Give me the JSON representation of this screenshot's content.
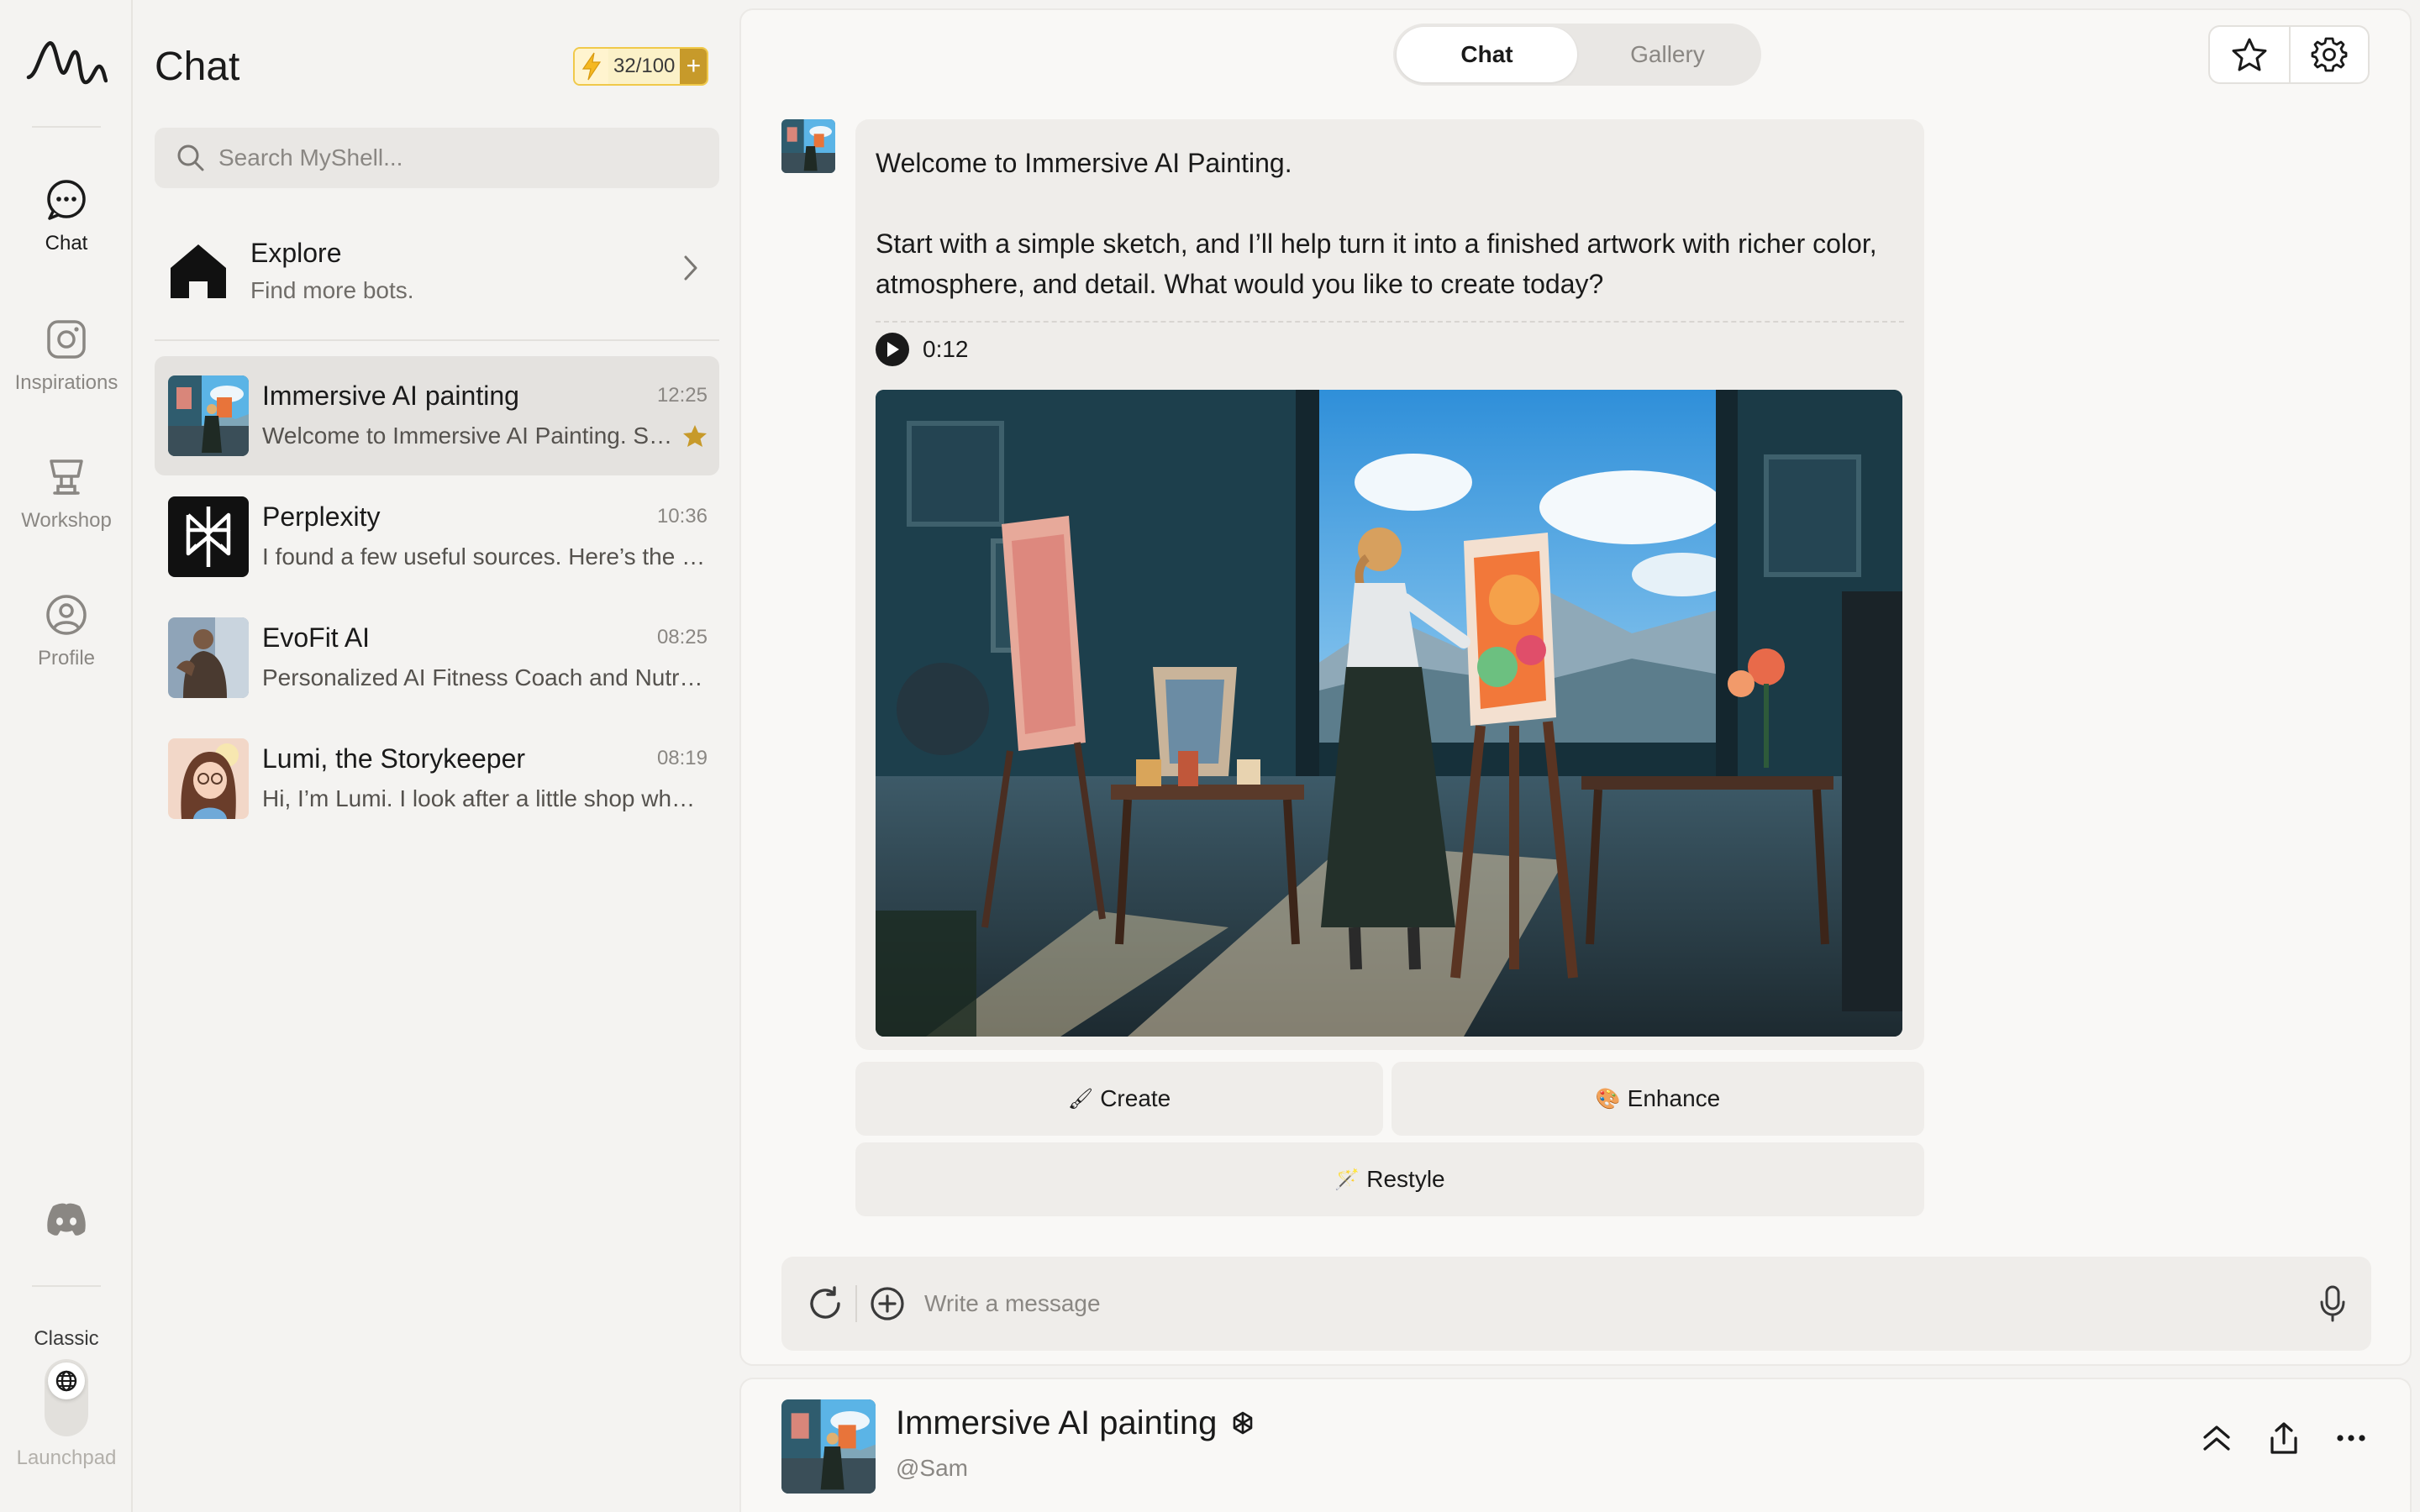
{
  "rail": {
    "items": [
      {
        "label": "Chat",
        "icon": "chat-bubble-icon"
      },
      {
        "label": "Inspirations",
        "icon": "instagram-icon"
      },
      {
        "label": "Workshop",
        "icon": "trophy-icon"
      },
      {
        "label": "Profile",
        "icon": "user-circle-icon"
      }
    ],
    "classic_label": "Classic",
    "launchpad_label": "Launchpad"
  },
  "list": {
    "title": "Chat",
    "credits": "32/100",
    "search_placeholder": "Search MyShell...",
    "explore": {
      "title": "Explore",
      "subtitle": "Find more bots."
    },
    "chats": [
      {
        "name": "Immersive AI painting",
        "time": "12:25",
        "preview": "Welcome to Immersive AI Painting. Start with a simple sketch",
        "starred": true
      },
      {
        "name": "Perplexity",
        "time": "10:36",
        "preview": "I found a few useful sources. Here’s the quick summary",
        "starred": false
      },
      {
        "name": "EvoFit AI",
        "time": "08:25",
        "preview": "Personalized AI Fitness Coach and Nutrition Planner",
        "starred": false
      },
      {
        "name": "Lumi, the Storykeeper",
        "time": "08:19",
        "preview": "Hi, I’m Lumi. I look after a little shop where stories live",
        "starred": false
      }
    ]
  },
  "main": {
    "tabs": [
      "Chat",
      "Gallery"
    ],
    "active_tab": "Chat",
    "message": {
      "p1": "Welcome to Immersive AI Painting.",
      "p2": "Start with a simple sketch, and I’ll help turn it into a finished artwork with richer color, atmosphere, and detail. What would you like to create today?",
      "audio_duration": "0:12"
    },
    "actions": {
      "create": "Create",
      "enhance": "Enhance",
      "restyle": "Restyle"
    },
    "composer_placeholder": "Write a message"
  },
  "footer": {
    "bot_name": "Immersive AI painting",
    "handle": "@Sam"
  },
  "colors": {
    "accent_gold": "#c79a2a",
    "credits_border": "#f0c94a",
    "active_row": "#e4e2df"
  }
}
